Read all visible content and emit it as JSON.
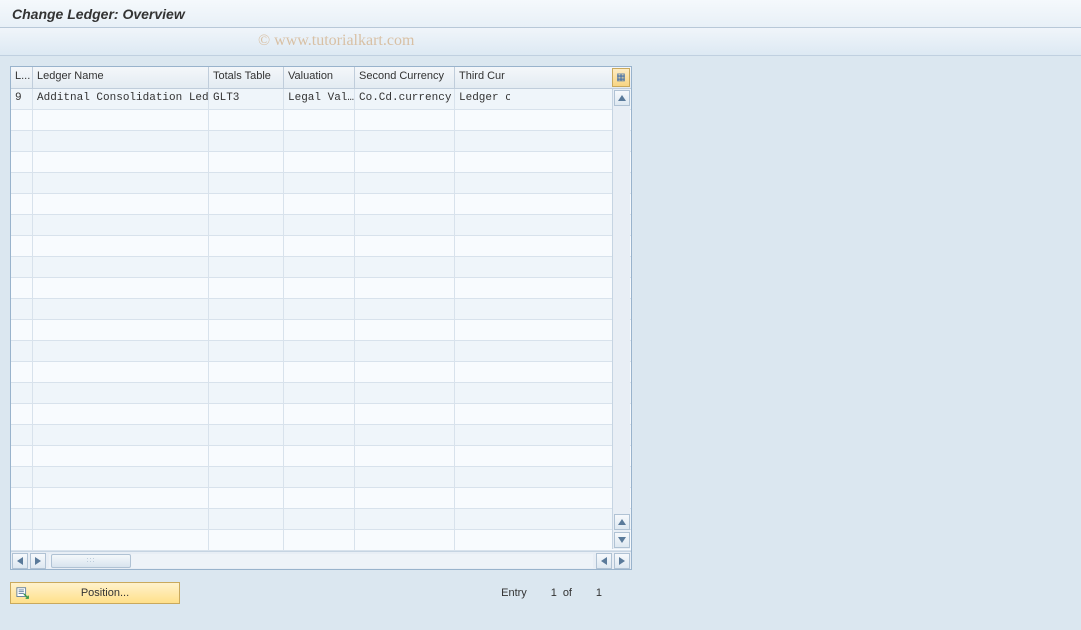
{
  "title": "Change Ledger: Overview",
  "watermark": "© www.tutorialkart.com",
  "table": {
    "columns": [
      "L...",
      "Ledger Name",
      "Totals Table",
      "Valuation",
      "Second Currency",
      "Third Cur"
    ],
    "rows": [
      {
        "c0": "9",
        "c1": "Additnal Consolidation Ledger",
        "c2": "GLT3",
        "c3": "Legal Val…",
        "c4": "Co.Cd.currency",
        "c5": "Ledger c"
      }
    ],
    "empty_rows": 21
  },
  "footer": {
    "position_label": "Position...",
    "entry_label": "Entry",
    "entry_current": "1",
    "entry_of": "of",
    "entry_total": "1"
  }
}
